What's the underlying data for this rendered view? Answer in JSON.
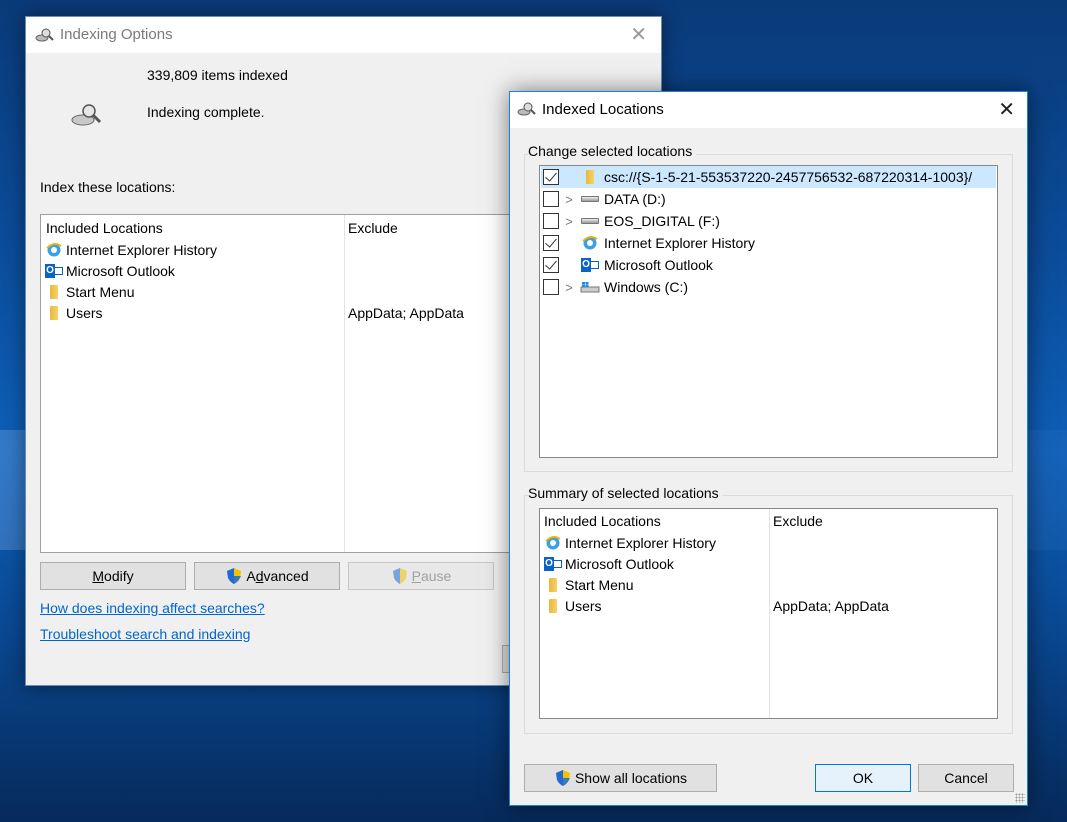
{
  "main_window": {
    "title": "Indexing Options",
    "items_count": "339,809 items indexed",
    "status": "Indexing complete.",
    "index_label": "Index these locations:",
    "columns": {
      "included": "Included Locations",
      "exclude": "Exclude"
    },
    "locations": [
      {
        "name": "Internet Explorer History",
        "icon": "ie-icon",
        "exclude": ""
      },
      {
        "name": "Microsoft Outlook",
        "icon": "outlook-icon",
        "exclude": ""
      },
      {
        "name": "Start Menu",
        "icon": "folder-icon",
        "exclude": ""
      },
      {
        "name": "Users",
        "icon": "folder-icon",
        "exclude": "AppData; AppData"
      }
    ],
    "buttons": {
      "modify": {
        "pre": "",
        "mnemonic": "M",
        "post": "odify"
      },
      "advanced": {
        "pre": "A",
        "mnemonic": "d",
        "post": "vanced"
      },
      "pause": {
        "pre": "",
        "mnemonic": "P",
        "post": "ause"
      }
    },
    "links": {
      "how": "How does indexing affect searches?",
      "troubleshoot": "Troubleshoot search and indexing"
    }
  },
  "dialog": {
    "title": "Indexed Locations",
    "change_group_label": "Change selected locations",
    "tree": [
      {
        "label": "csc://{S-1-5-21-553537220-2457756532-687220314-1003}/",
        "checked": true,
        "expandable": false,
        "icon": "folder-icon",
        "selected": true
      },
      {
        "label": "DATA (D:)",
        "checked": false,
        "expandable": true,
        "icon": "drive-icon",
        "selected": false
      },
      {
        "label": "EOS_DIGITAL (F:)",
        "checked": false,
        "expandable": true,
        "icon": "drive-icon",
        "selected": false
      },
      {
        "label": "Internet Explorer History",
        "checked": true,
        "expandable": false,
        "icon": "ie-icon",
        "selected": false
      },
      {
        "label": "Microsoft Outlook",
        "checked": true,
        "expandable": false,
        "icon": "outlook-icon",
        "selected": false
      },
      {
        "label": "Windows (C:)",
        "checked": false,
        "expandable": true,
        "icon": "windows-drive-icon",
        "selected": false
      }
    ],
    "summary_group_label": "Summary of selected locations",
    "summary_columns": {
      "included": "Included Locations",
      "exclude": "Exclude"
    },
    "summary": [
      {
        "name": "Internet Explorer History",
        "icon": "ie-icon",
        "exclude": ""
      },
      {
        "name": "Microsoft Outlook",
        "icon": "outlook-icon",
        "exclude": ""
      },
      {
        "name": "Start Menu",
        "icon": "folder-icon",
        "exclude": ""
      },
      {
        "name": "Users",
        "icon": "folder-icon",
        "exclude": "AppData; AppData"
      }
    ],
    "buttons": {
      "show_all": "Show all locations",
      "ok": "OK",
      "cancel": "Cancel"
    }
  },
  "colors": {
    "link": "#0066cc",
    "selection": "#cce8ff",
    "dialog_border": "#1883d7",
    "desktop": "#0b4c9a"
  }
}
